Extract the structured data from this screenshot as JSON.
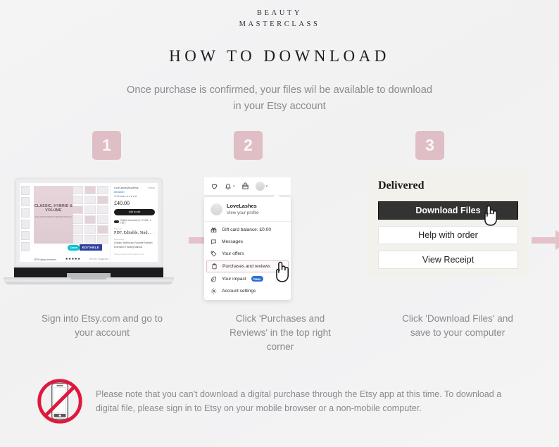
{
  "brand": {
    "line1": "BEAUTY",
    "line2": "MASTERCLASS"
  },
  "header": {
    "title": "HOW TO DOWNLOAD",
    "intro_line1": "Once purchase is confirmed, your files wil be available to download",
    "intro_line2": "in your Etsy account"
  },
  "colors": {
    "background": "#f3f3f4",
    "accent_pink": "#dfbec6",
    "arrow_pink": "#e3c2ca",
    "panel_cream": "#f2f1ec",
    "primary_button": "#333333",
    "text_gray": "#8a8a90",
    "no_phone_red": "#e0183c",
    "new_badge_blue": "#2f6fd0"
  },
  "steps": [
    {
      "number": "1",
      "caption_line1": "Sign into Etsy.com and go to",
      "caption_line2": "your account"
    },
    {
      "number": "2",
      "caption_line1": "Click 'Purchases and",
      "caption_line2": "Reviews' in the top right",
      "caption_line3": "corner"
    },
    {
      "number": "3",
      "caption_line1": "Click 'Download Files' and",
      "caption_line2": "save to your computer"
    }
  ],
  "laptop": {
    "listing": {
      "cover_title_line1": "CLASSIC,",
      "cover_title_line2": "HYBRID &",
      "cover_title_line3": "VOLUME",
      "cover_sub": "EYELASH EXTENSION TRAINING MANUAL",
      "cover_brand": "BEAUTY",
      "canva_label": "Canva",
      "editable_label": "EDITABLE",
      "reviews_count": "103 shop reviews",
      "stars": "★★★★★",
      "sort_label": "Sort by: Suggested",
      "shop_name": "LoveLashesAcademy",
      "follow_label": "Follow",
      "bestseller": "Bestseller",
      "rating_line": "1744 sales   ★★★★★",
      "price": "£40.00",
      "add_to_cart": "Add to cart",
      "instant_download": "Digital download (17.9 MB | 1 PDF)",
      "more_like_label": "More on",
      "file_type": "PDF, Editable, Stud...",
      "desc_label": "Description",
      "desc_line1": "Classic, Hybrid and Volume Eyelash",
      "desc_line2": "Extension Training Manual",
      "footer_note": "Need a manual to be made to suit"
    }
  },
  "etsy_menu": {
    "top_icons": [
      "heart-icon",
      "bell-icon",
      "cart-icon",
      "avatar-icon"
    ],
    "account_name": "LoveLashes",
    "account_sub": "View your profile",
    "items": [
      {
        "label": "Gift card balance: £0.00",
        "icon": "gift-icon",
        "highlighted": false
      },
      {
        "label": "Messages",
        "icon": "message-icon",
        "highlighted": false
      },
      {
        "label": "Your offers",
        "icon": "tag-icon",
        "highlighted": false
      },
      {
        "label": "Purchases and reviews",
        "icon": "clipboard-icon",
        "highlighted": true
      },
      {
        "label": "Your impact",
        "icon": "leaf-icon",
        "highlighted": false,
        "badge": "New"
      },
      {
        "label": "Account settings",
        "icon": "gear-icon",
        "highlighted": false
      }
    ]
  },
  "delivered_panel": {
    "status": "Delivered",
    "buttons": [
      {
        "label": "Download Files",
        "style": "primary"
      },
      {
        "label": "Help with order",
        "style": "secondary"
      },
      {
        "label": "View Receipt",
        "style": "secondary"
      }
    ]
  },
  "footer_note": {
    "icon": "no-mobile-phone-icon",
    "line1": "Please note that you can't download a digital purchase through the Etsy app at this time. To download a",
    "line2": "digital file, please sign in to Etsy on your mobile browser or a non-mobile computer."
  }
}
